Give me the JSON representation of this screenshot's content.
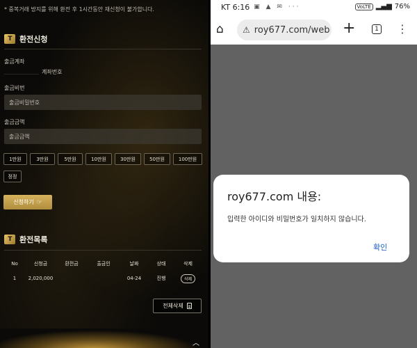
{
  "left": {
    "notice": "* 중복거래 방지를 위해 환전 후 1시간동안 재신청이 불가합니다.",
    "logo_text": "T",
    "exchange_section": {
      "title": "환전신청",
      "account_label": "출금계좌",
      "account_number_label": "계좌번호",
      "password_label": "출금비번",
      "password_placeholder": "출금비밀번호",
      "amount_label": "출금금액",
      "amount_placeholder": "출금금액",
      "amount_buttons": [
        "1만원",
        "3만원",
        "5만원",
        "10만원",
        "30만원",
        "50만원",
        "100만원"
      ],
      "reset_label": "정정",
      "apply_label": "신청하기",
      "apply_icon": "pointing-hand-icon"
    },
    "history_section": {
      "title": "환전목록",
      "columns": [
        "No",
        "신청금",
        "환전금",
        "출금인",
        "날짜",
        "상태",
        "삭제"
      ],
      "rows": [
        {
          "no": "1",
          "request": "2,020,000",
          "exchanged": "",
          "withdrawer": "",
          "date": "04-24",
          "status": "진행",
          "delete": "삭제"
        }
      ],
      "delete_all_label": "전체삭제"
    }
  },
  "right": {
    "status_bar": {
      "carrier": "KT 6:16",
      "status_icons": "▣ ▲ ✉ ···",
      "volte": "VoLTE",
      "battery": "76%"
    },
    "browser": {
      "url": "roy677.com/web",
      "tab_count": "1"
    },
    "dialog": {
      "title": "roy677.com 내용:",
      "message": "입력한 아이디와 비밀번호가 일치하지 않습니다.",
      "ok_label": "확인"
    }
  }
}
